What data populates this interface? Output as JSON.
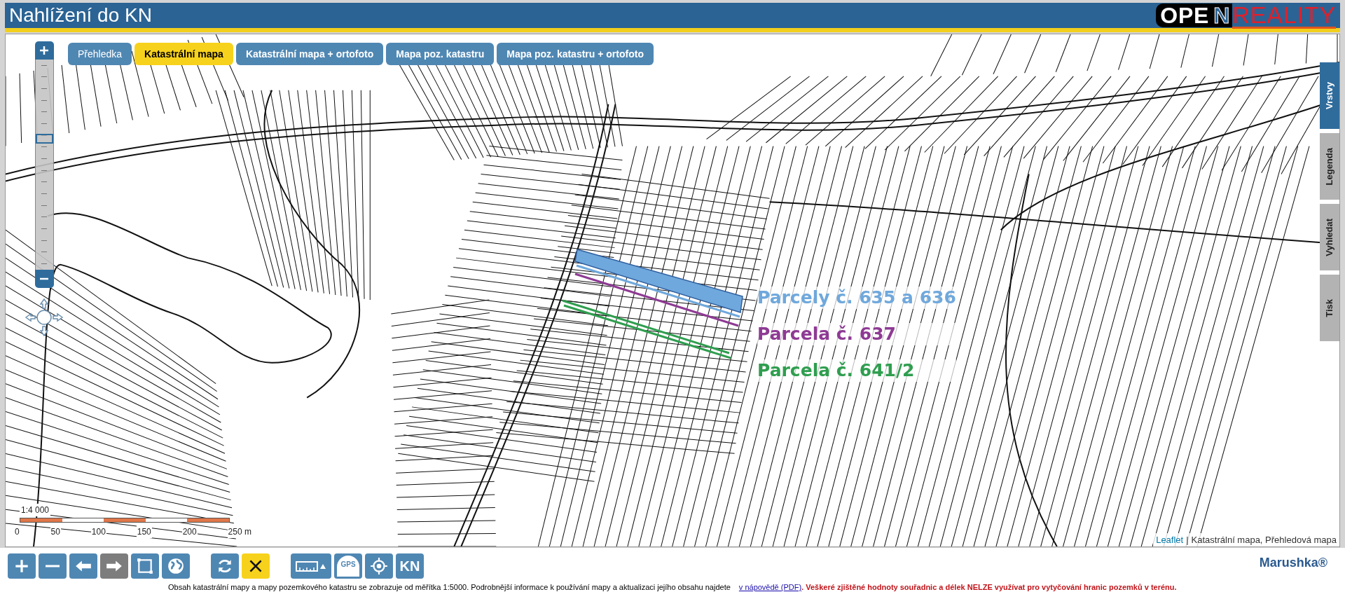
{
  "header": {
    "title": "Nahlížení do KN",
    "logo": {
      "part_1": "OPE",
      "part_2": "N",
      "part_3": "REALITY"
    }
  },
  "map_tabs": [
    {
      "label": "Přehledka",
      "selected": false
    },
    {
      "label": "Katastrální mapa",
      "selected": true
    },
    {
      "label": "Katastrální mapa + ortofoto",
      "selected": false
    },
    {
      "label": "Mapa poz. katastru",
      "selected": false
    },
    {
      "label": "Mapa poz. katastru + ortofoto",
      "selected": false
    }
  ],
  "side_tabs": [
    {
      "label": "Vrstvy",
      "selected": true
    },
    {
      "label": "Legenda",
      "selected": false
    },
    {
      "label": "Vyhledat",
      "selected": false
    },
    {
      "label": "Tisk",
      "selected": false
    }
  ],
  "zoom_slider": {
    "level": 0.63
  },
  "parcels": [
    {
      "label": "Parcely č. 635 a 636",
      "color": "#6fa8dc"
    },
    {
      "label": "Parcela č. 637",
      "color": "#8e3a94"
    },
    {
      "label": "Parcela č. 641/2",
      "color": "#2f9e4f"
    }
  ],
  "scale": {
    "ratio": "1:4 000",
    "ticks": [
      "0",
      "50",
      "100",
      "150",
      "200",
      "250 m"
    ]
  },
  "attribution": {
    "link": "Leaflet",
    "separator": "|",
    "text": "Katastrální mapa, Přehledová mapa"
  },
  "toolbar": [
    {
      "kind": "plus",
      "disabled": false,
      "active": false
    },
    {
      "kind": "minus",
      "disabled": false,
      "active": false
    },
    {
      "kind": "back",
      "disabled": false,
      "active": false
    },
    {
      "kind": "forward",
      "disabled": true,
      "active": false
    },
    {
      "kind": "rect",
      "disabled": false,
      "active": false
    },
    {
      "kind": "globe",
      "disabled": false,
      "active": false
    },
    {
      "kind": "gap"
    },
    {
      "kind": "refresh",
      "disabled": false,
      "active": false
    },
    {
      "kind": "close",
      "disabled": false,
      "active": true
    },
    {
      "kind": "gap"
    },
    {
      "kind": "ruler",
      "disabled": false,
      "active": false
    },
    {
      "kind": "gps",
      "disabled": false,
      "active": false,
      "label": "GPS"
    },
    {
      "kind": "locate",
      "disabled": false,
      "active": false
    },
    {
      "kind": "text",
      "disabled": false,
      "active": false,
      "label": "KN"
    }
  ],
  "brand": "Marushka®",
  "footer": {
    "text": "Obsah katastrální mapy a mapy pozemkového katastru se zobrazuje od měřítka 1:5000. Podrobnější informace k používání mapy a aktualizaci jejího obsahu najdete",
    "link": "v nápovědě (PDF)",
    "warning": ". Veškeré zjištěné hodnoty souřadnic a délek NELZE využívat pro vytyčování hranic pozemků v terénu."
  }
}
